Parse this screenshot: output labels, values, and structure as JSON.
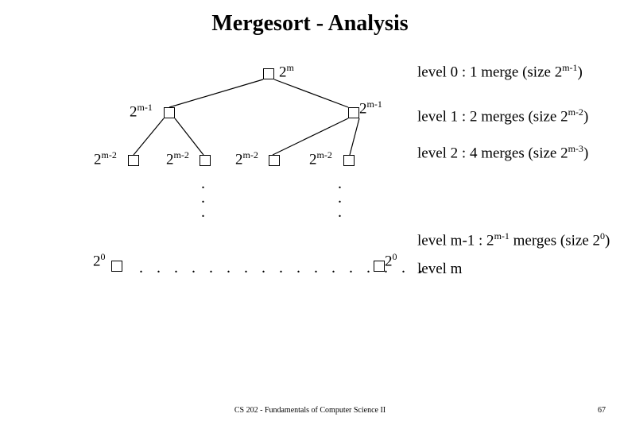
{
  "title": "Mergesort - Analysis",
  "tree": {
    "root_label": [
      "2",
      "m"
    ],
    "l1_left": [
      "2",
      "m-1"
    ],
    "l1_right": [
      "2",
      "m-1"
    ],
    "l2_a": [
      "2",
      "m-2"
    ],
    "l2_b": [
      "2",
      "m-2"
    ],
    "l2_c": [
      "2",
      "m-2"
    ],
    "l2_d": [
      "2",
      "m-2"
    ],
    "leaf_left": [
      "2",
      "0"
    ],
    "leaf_right": [
      "2",
      "0"
    ]
  },
  "annotations": {
    "level0": [
      "level 0 : 1 merge (size 2",
      "m-1",
      ")"
    ],
    "level1": [
      "level 1 : 2 merges (size 2",
      "m-2",
      ")"
    ],
    "level2": [
      "level 2 : 4 merges (size 2",
      "m-3",
      ")"
    ],
    "levelm1": [
      "level m-1 : 2",
      "m-1",
      " merges (size 2",
      "0",
      ")"
    ],
    "levelm": "level m"
  },
  "footer": "CS 202 - Fundamentals of Computer Science II",
  "page": "67"
}
